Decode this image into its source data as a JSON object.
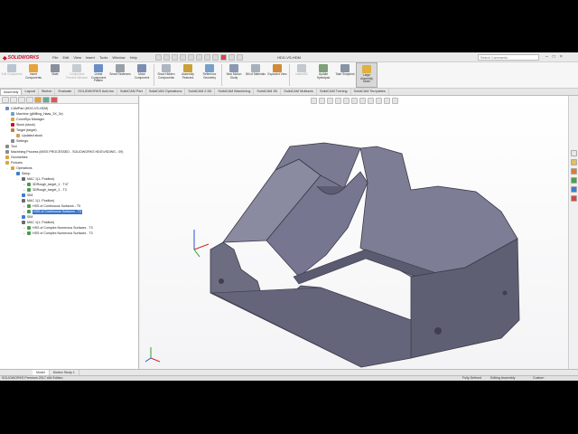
{
  "app": {
    "brand": "SOLIDWORKS",
    "doc_title": "HDG-VS-HDM",
    "search_placeholder": "Search Commands"
  },
  "menu": [
    "File",
    "Edit",
    "View",
    "Insert",
    "Tools",
    "Window",
    "Help"
  ],
  "ribbon": [
    {
      "label": "Edit Component",
      "disabled": true,
      "color": "#b9c4d2"
    },
    {
      "label": "Insert Components",
      "disabled": false,
      "color": "#e8a23a"
    },
    {
      "label": "Mate",
      "disabled": false,
      "color": "#8a8fa0"
    },
    {
      "label": "Component Preview Window",
      "disabled": true,
      "color": "#c7cbd2"
    },
    {
      "label": "Linear Component Pattern",
      "disabled": false,
      "color": "#6c8ec4"
    },
    {
      "label": "Smart Fasteners",
      "disabled": false,
      "color": "#9aa0a8"
    },
    {
      "label": "Move Component",
      "disabled": false,
      "color": "#7a8fb0"
    },
    {
      "label": "Show Hidden Components",
      "disabled": false,
      "color": "#aeb6c4"
    },
    {
      "label": "Assembly Features",
      "disabled": false,
      "color": "#c9a23a"
    },
    {
      "label": "Reference Geometry",
      "disabled": false,
      "color": "#7aa0c8"
    },
    {
      "label": "New Motion Study",
      "disabled": false,
      "color": "#8a9ab0"
    },
    {
      "label": "Bill of Materials",
      "disabled": false,
      "color": "#a8b0bc"
    },
    {
      "label": "Exploded View",
      "disabled": false,
      "color": "#d08a3a"
    },
    {
      "label": "Instant3D",
      "disabled": true,
      "color": "#c4c8cf"
    },
    {
      "label": "Update Speedpak",
      "disabled": false,
      "color": "#7ea07a"
    },
    {
      "label": "Take Snapshot",
      "disabled": false,
      "color": "#8894a6"
    },
    {
      "label": "Large Assembly Mode",
      "disabled": false,
      "color": "#e0b040"
    }
  ],
  "cmd_tabs": [
    {
      "label": "Assembly",
      "active": true
    },
    {
      "label": "Layout",
      "active": false
    },
    {
      "label": "Sketch",
      "active": false
    },
    {
      "label": "Evaluate",
      "active": false
    },
    {
      "label": "SOLIDWORKS Add-Ins",
      "active": false
    },
    {
      "label": "SolidCAM Part",
      "active": false
    },
    {
      "label": "SolidCAM Operations",
      "active": false
    },
    {
      "label": "SolidCAM 2.5D",
      "active": false
    },
    {
      "label": "SolidCAM iMachining",
      "active": false
    },
    {
      "label": "SolidCAM 3D",
      "active": false
    },
    {
      "label": "SolidCAM Multiaxis",
      "active": false
    },
    {
      "label": "SolidCAM Turning",
      "active": false
    },
    {
      "label": "SolidCAM Templates",
      "active": false
    }
  ],
  "tree": [
    {
      "indent": 0,
      "toggle": "",
      "color": "#6a8fc0",
      "text": "CAMPart (HDG-VS-HDM)",
      "hl": false
    },
    {
      "indent": 1,
      "toggle": "",
      "color": "#6aa0d0",
      "text": "Machine (gMilling_Haas_3X_3x)",
      "hl": false
    },
    {
      "indent": 1,
      "toggle": "",
      "color": "#d9a441",
      "text": "CoordSys Manager",
      "hl": false
    },
    {
      "indent": 1,
      "toggle": "",
      "color": "#c8102e",
      "text": "Stock (stock)",
      "hl": false
    },
    {
      "indent": 1,
      "toggle": "",
      "color": "#c87a3a",
      "text": "Target (target)",
      "hl": false
    },
    {
      "indent": 2,
      "toggle": "",
      "color": "#c8a060",
      "text": "Updated stock",
      "hl": false
    },
    {
      "indent": 1,
      "toggle": "",
      "color": "#8a8a8a",
      "text": "Settings",
      "hl": false
    },
    {
      "indent": 0,
      "toggle": "",
      "color": "#8a8a8a",
      "text": "Tool",
      "hl": false
    },
    {
      "indent": 0,
      "toggle": "",
      "color": "#8a8a8a",
      "text": "Machining Process (MISS PROCESSED - SOLIDWORKS HDG\\VSDWG - 09)",
      "hl": false
    },
    {
      "indent": 0,
      "toggle": "",
      "color": "#d9a441",
      "text": "Geometries",
      "hl": false
    },
    {
      "indent": 0,
      "toggle": "",
      "color": "#d9a441",
      "text": "Fixtures",
      "hl": false
    },
    {
      "indent": 1,
      "toggle": "-",
      "color": "#d9a441",
      "text": "Operations",
      "hl": false
    },
    {
      "indent": 2,
      "toggle": "-",
      "color": "#3a7fd0",
      "text": "Setup",
      "hl": false
    },
    {
      "indent": 3,
      "toggle": "-",
      "color": "#6a6a6a",
      "text": "MAC 1(1- Position)",
      "hl": false
    },
    {
      "indent": 4,
      "toggle": "+",
      "color": "#4a9a4a",
      "text": "3DRough_target_1 - T47",
      "hl": false
    },
    {
      "indent": 4,
      "toggle": "+",
      "color": "#4a9a4a",
      "text": "3DRough_target_1 - T3",
      "hl": false
    },
    {
      "indent": 3,
      "toggle": "-",
      "color": "#3a7fd0",
      "text": "SIM",
      "hl": false
    },
    {
      "indent": 3,
      "toggle": "-",
      "color": "#6a6a6a",
      "text": "MAC 1(1- Position)",
      "hl": false
    },
    {
      "indent": 4,
      "toggle": "+",
      "color": "#4a9a4a",
      "text": "HSS of Continuous Surfaces - T5",
      "hl": false
    },
    {
      "indent": 4,
      "toggle": "+",
      "color": "#4a9a4a",
      "text": "HSS of Continuous Surfaces - T3",
      "hl": true
    },
    {
      "indent": 3,
      "toggle": "-",
      "color": "#3a7fd0",
      "text": "SIM",
      "hl": false
    },
    {
      "indent": 3,
      "toggle": "-",
      "color": "#6a6a6a",
      "text": "MAC 1(1- Position)",
      "hl": false
    },
    {
      "indent": 4,
      "toggle": "+",
      "color": "#4a9a4a",
      "text": "HSS of Complex Numerous Surfaces - T3",
      "hl": false
    },
    {
      "indent": 4,
      "toggle": "+",
      "color": "#4a9a4a",
      "text": "HSS of Complex Numerous Surfaces - T3",
      "hl": false
    }
  ],
  "model_tabs": [
    {
      "label": "Model",
      "active": true
    },
    {
      "label": "Motion Study 1",
      "active": false
    }
  ],
  "status": {
    "edition": "SOLIDWORKS Premium 2017 x64 Edition",
    "defined": "Fully Defined",
    "editing": "Editing Assembly",
    "units": "Custom"
  }
}
